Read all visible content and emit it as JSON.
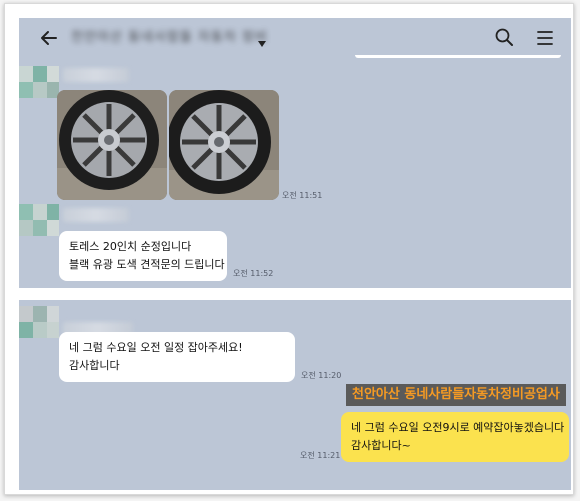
{
  "header": {
    "room_title": "천안아산 동네사람들 자동차 정비",
    "back_icon": "arrow-left-icon",
    "search_icon": "search-icon",
    "menu_icon": "hamburger-menu-icon"
  },
  "colors": {
    "chat_background": "#bcc6d6",
    "my_bubble": "#fbe24e",
    "other_bubble": "#ffffff",
    "watermark_text": "#f59a23"
  },
  "messages": [
    {
      "kind": "photos",
      "sender": "other",
      "photo_count": 2,
      "time": "오전 11:51"
    },
    {
      "kind": "text",
      "sender": "other",
      "lines": [
        "토레스 20인치 순정입니다",
        "블랙 유광 도색 견적문의 드립니다"
      ],
      "time": "오전 11:52"
    },
    {
      "kind": "text",
      "sender": "other",
      "lines": [
        "네 그럼 수요일 오전 일정 잡아주세요!",
        "감사합니다"
      ],
      "time": "오전 11:20"
    },
    {
      "kind": "text",
      "sender": "me",
      "lines": [
        "네 그럼 수요일 오전9시로 예약잡아놓겠습니다",
        "감사합니다~"
      ],
      "time": "오전 11:21"
    }
  ],
  "watermark": "천안아산 동네사람들자동차정비공업사"
}
